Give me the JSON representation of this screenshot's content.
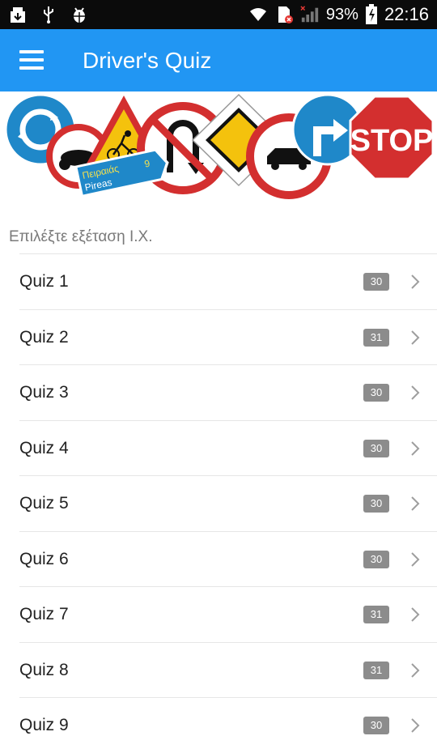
{
  "status_bar": {
    "battery": "93%",
    "time": "22:16",
    "icons": [
      "download-icon",
      "usb-icon",
      "android-debug-icon",
      "wifi-icon",
      "sim-error-icon",
      "signal-icon",
      "battery-charging-icon"
    ]
  },
  "app_bar": {
    "title": "Driver's Quiz",
    "menu_icon": "hamburger-menu-icon",
    "color": "#2196f3"
  },
  "banner": {
    "sign_text_stop": "STOP",
    "sign_text_greek": "Πειραιάς",
    "sign_text_latin": "Pireas",
    "sign_text_number": "9"
  },
  "subtitle": "Επιλέξτε εξέταση Ι.Χ.",
  "quizzes": [
    {
      "label": "Quiz 1",
      "count": "30"
    },
    {
      "label": "Quiz 2",
      "count": "31"
    },
    {
      "label": "Quiz 3",
      "count": "30"
    },
    {
      "label": "Quiz 4",
      "count": "30"
    },
    {
      "label": "Quiz 5",
      "count": "30"
    },
    {
      "label": "Quiz 6",
      "count": "30"
    },
    {
      "label": "Quiz 7",
      "count": "31"
    },
    {
      "label": "Quiz 8",
      "count": "31"
    },
    {
      "label": "Quiz 9",
      "count": "30"
    }
  ]
}
